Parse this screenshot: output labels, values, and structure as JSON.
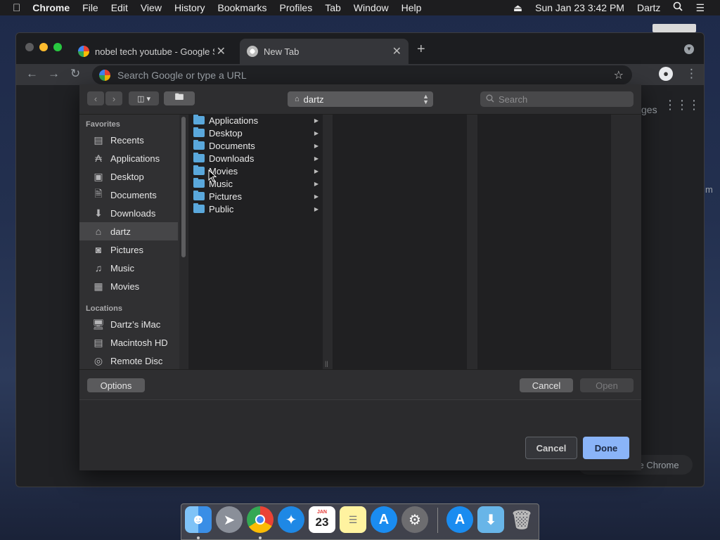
{
  "menubar": {
    "apple_icon": "apple-icon",
    "app_name": "Chrome",
    "items": [
      "File",
      "Edit",
      "View",
      "History",
      "Bookmarks",
      "Profiles",
      "Tab",
      "Window",
      "Help"
    ],
    "clock": "Sun Jan 23  3:42 PM",
    "user": "Dartz"
  },
  "browser": {
    "tabs": [
      {
        "title": "nobel tech youtube - Google S",
        "active": false
      },
      {
        "title": "New Tab",
        "active": true
      }
    ],
    "omnibox_placeholder": "Search Google or type a URL",
    "ntp_partial_text": "ges",
    "ntp_customize": "ze Chrome",
    "ntp_right_fragment": "m"
  },
  "dialog": {
    "location": "dartz",
    "search_placeholder": "Search",
    "sidebar": {
      "favorites_header": "Favorites",
      "favorites": [
        {
          "label": "Recents",
          "icon": "clock-icon"
        },
        {
          "label": "Applications",
          "icon": "applications-icon"
        },
        {
          "label": "Desktop",
          "icon": "desktop-icon"
        },
        {
          "label": "Documents",
          "icon": "document-icon"
        },
        {
          "label": "Downloads",
          "icon": "download-icon"
        },
        {
          "label": "dartz",
          "icon": "home-icon",
          "selected": true
        },
        {
          "label": "Pictures",
          "icon": "camera-icon"
        },
        {
          "label": "Music",
          "icon": "music-icon"
        },
        {
          "label": "Movies",
          "icon": "film-icon"
        }
      ],
      "locations_header": "Locations",
      "locations": [
        {
          "label": "Dartz’s iMac",
          "icon": "computer-icon"
        },
        {
          "label": "Macintosh HD",
          "icon": "hard-drive-icon"
        },
        {
          "label": "Remote Disc",
          "icon": "disc-icon"
        }
      ]
    },
    "folders": [
      "Applications",
      "Desktop",
      "Documents",
      "Downloads",
      "Movies",
      "Music",
      "Pictures",
      "Public"
    ],
    "options_label": "Options",
    "cancel_label": "Cancel",
    "open_label": "Open"
  },
  "sheet_buttons": {
    "cancel_label": "Cancel",
    "done_label": "Done"
  },
  "dock": {
    "calendar_month": "JAN",
    "calendar_day": "23",
    "apps": [
      "finder-icon",
      "launchpad-icon",
      "chrome-icon",
      "safari-icon",
      "calendar-icon",
      "notes-icon",
      "app-store-icon",
      "system-preferences-icon",
      "app-store-icon",
      "downloads-folder-icon",
      "trash-icon"
    ]
  },
  "colors": {
    "accent_button": "#8ab4f8",
    "folder_blue": "#5aa8dc",
    "selection": "#464648"
  }
}
